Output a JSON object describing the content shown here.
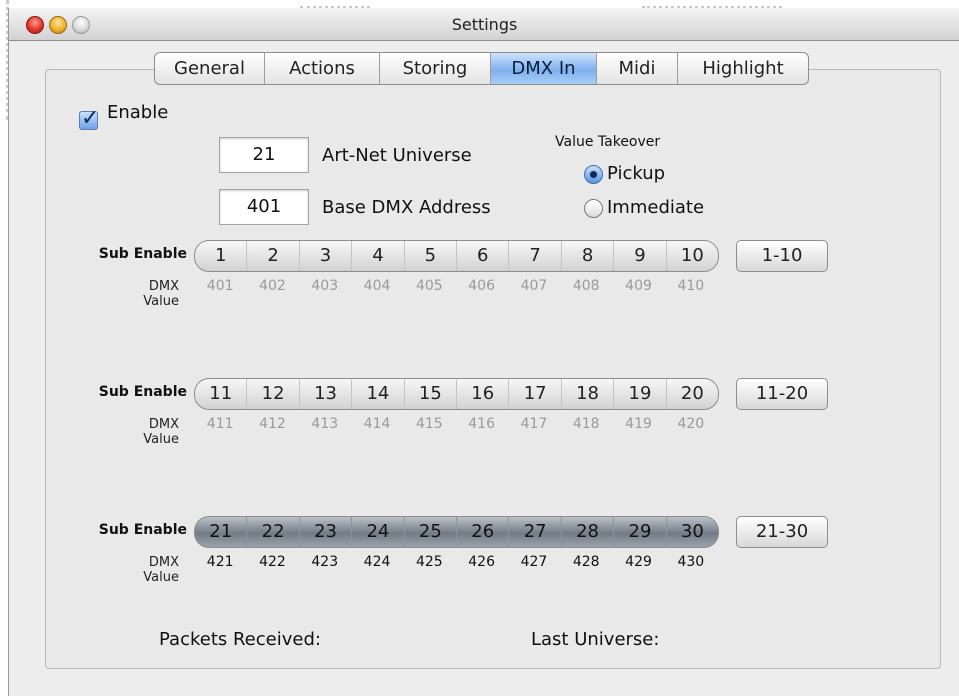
{
  "window": {
    "title": "Settings"
  },
  "tabs": [
    "General",
    "Actions",
    "Storing",
    "DMX In",
    "Midi",
    "Highlight"
  ],
  "enable_label": "Enable",
  "fields": {
    "universe": {
      "value": "21",
      "label": "Art-Net Universe"
    },
    "base_address": {
      "value": "401",
      "label": "Base DMX Address"
    }
  },
  "takeover": {
    "heading": "Value Takeover",
    "pickup": "Pickup",
    "immediate": "Immediate"
  },
  "sub_enable_label": "Sub Enable",
  "dmx_label": "DMX",
  "value_label": "Value",
  "rows": [
    {
      "subs": [
        "1",
        "2",
        "3",
        "4",
        "5",
        "6",
        "7",
        "8",
        "9",
        "10"
      ],
      "values": [
        "401",
        "402",
        "403",
        "404",
        "405",
        "406",
        "407",
        "408",
        "409",
        "410"
      ],
      "range": "1-10"
    },
    {
      "subs": [
        "11",
        "12",
        "13",
        "14",
        "15",
        "16",
        "17",
        "18",
        "19",
        "20"
      ],
      "values": [
        "411",
        "412",
        "413",
        "414",
        "415",
        "416",
        "417",
        "418",
        "419",
        "420"
      ],
      "range": "11-20"
    },
    {
      "subs": [
        "21",
        "22",
        "23",
        "24",
        "25",
        "26",
        "27",
        "28",
        "29",
        "30"
      ],
      "values": [
        "421",
        "422",
        "423",
        "424",
        "425",
        "426",
        "427",
        "428",
        "429",
        "430"
      ],
      "range": "21-30"
    }
  ],
  "status": {
    "packets": "Packets Received:",
    "last_universe": "Last Universe:"
  }
}
